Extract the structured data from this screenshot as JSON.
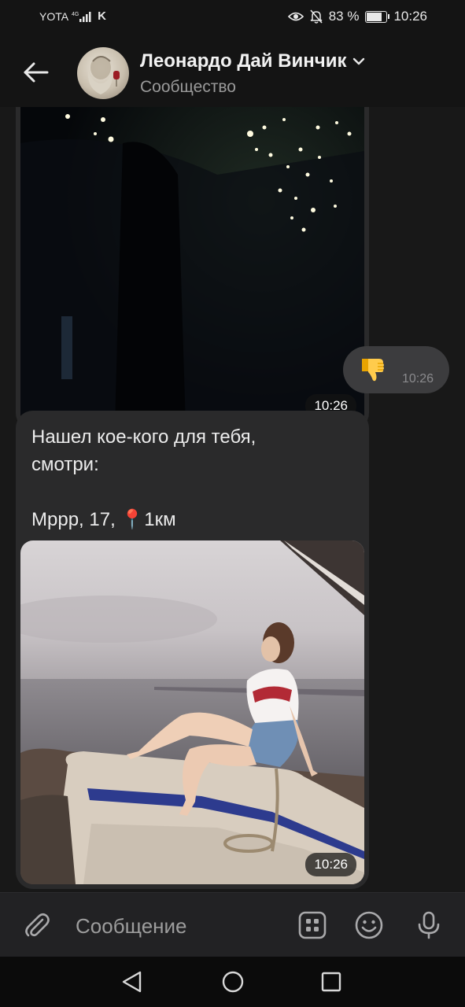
{
  "status_bar": {
    "carrier": "YOTA",
    "network": "4G",
    "extra": "K",
    "battery": "83 %",
    "battery_level": 0.83,
    "time": "10:26"
  },
  "header": {
    "title": "Леонардо Дай Винчик",
    "subtitle": "Сообщество"
  },
  "messages": [
    {
      "direction": "incoming",
      "type": "video",
      "time": "10:26"
    },
    {
      "direction": "outgoing",
      "type": "emoji",
      "emoji": "thumbs-down",
      "time": "10:26"
    },
    {
      "direction": "incoming",
      "type": "text+photo",
      "text_line1": "Нашел кое-кого для тебя,",
      "text_line2": "смотри:",
      "profile_line": "Мррр, 17, 📍1км",
      "time": "10:26"
    }
  ],
  "composer": {
    "placeholder": "Сообщение"
  },
  "icons": {
    "back": "arrow-left-icon",
    "dropdown": "chevron-down-icon",
    "attach": "paperclip-icon",
    "keyboard": "bot-keyboard-icon",
    "emoji": "smiley-icon",
    "voice": "microphone-icon",
    "nav_back": "triangle-back-icon",
    "nav_home": "circle-home-icon",
    "nav_recent": "square-recent-icon"
  },
  "colors": {
    "background": "#181818",
    "bubble_incoming": "#2a2a2b",
    "bubble_outgoing": "#3c3c3e",
    "accent_text": "#ffffff"
  }
}
